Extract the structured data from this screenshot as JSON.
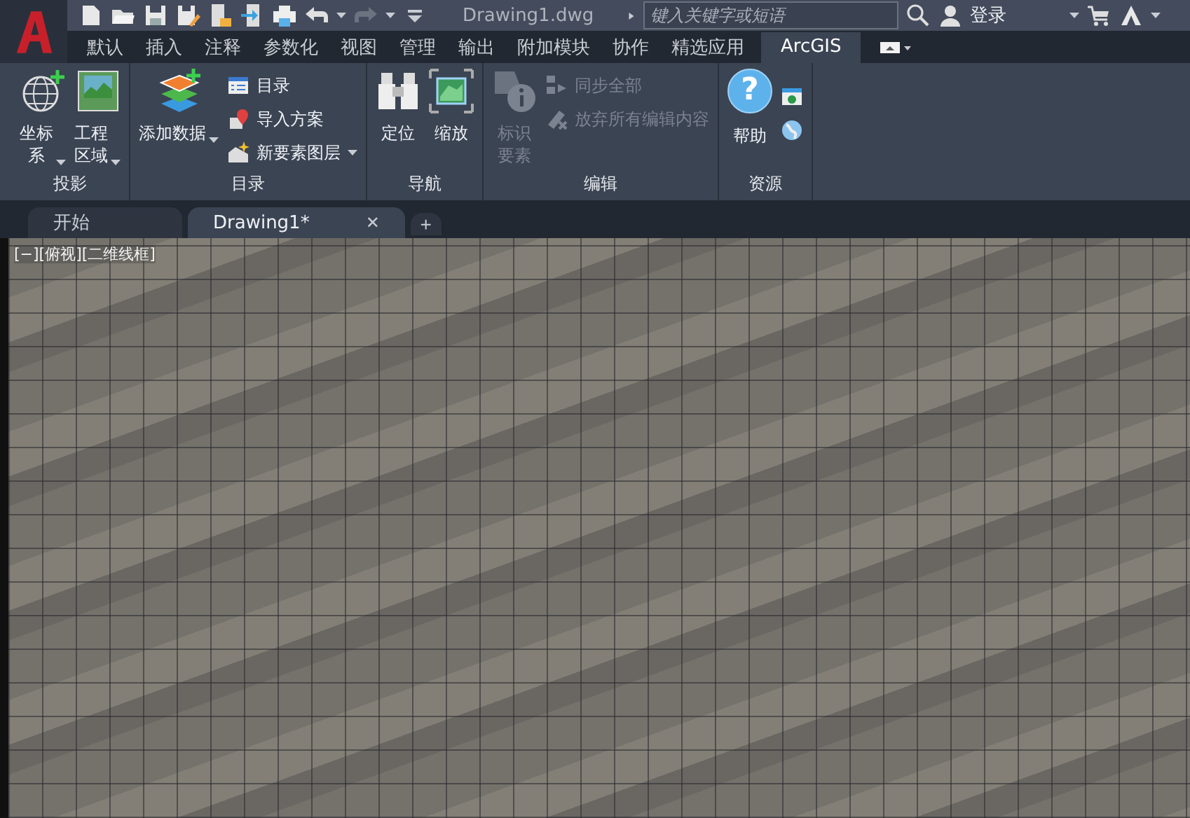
{
  "title_bar": {
    "title": "Drawing1.dwg",
    "search": {
      "placeholder": "键入关键字或短语"
    },
    "login": "登录"
  },
  "ribbon_tabs": [
    {
      "label": "默认",
      "selected": false
    },
    {
      "label": "插入",
      "selected": false
    },
    {
      "label": "注释",
      "selected": false
    },
    {
      "label": "参数化",
      "selected": false
    },
    {
      "label": "视图",
      "selected": false
    },
    {
      "label": "管理",
      "selected": false
    },
    {
      "label": "输出",
      "selected": false
    },
    {
      "label": "附加模块",
      "selected": false
    },
    {
      "label": "协作",
      "selected": false
    },
    {
      "label": "精选应用",
      "selected": false
    },
    {
      "label": "ArcGIS",
      "selected": true
    }
  ],
  "ribbon_panels": [
    {
      "title": "投影",
      "groups": [
        {
          "kind": "large",
          "label_lines": [
            "坐标",
            "系"
          ],
          "dropdown": true,
          "disabled": false
        },
        {
          "kind": "large",
          "label_lines": [
            "工程",
            "区域"
          ],
          "dropdown": true,
          "disabled": false
        }
      ]
    },
    {
      "title": "目录",
      "groups": [
        {
          "kind": "large",
          "label_lines": [
            "添加数据"
          ],
          "dropdown": true,
          "disabled": false
        },
        {
          "kind": "stack",
          "items": [
            {
              "label": "目录",
              "dropdown": false,
              "disabled": false
            },
            {
              "label": "导入方案",
              "dropdown": false,
              "disabled": false
            },
            {
              "label": "新要素图层",
              "dropdown": true,
              "disabled": false
            }
          ]
        }
      ]
    },
    {
      "title": "导航",
      "groups": [
        {
          "kind": "large",
          "label_lines": [
            "定位"
          ],
          "dropdown": false,
          "disabled": false
        },
        {
          "kind": "large",
          "label_lines": [
            "缩放"
          ],
          "dropdown": false,
          "disabled": false
        }
      ]
    },
    {
      "title": "编辑",
      "groups": [
        {
          "kind": "large",
          "label_lines": [
            "标识",
            "要素"
          ],
          "dropdown": false,
          "disabled": true
        },
        {
          "kind": "stack",
          "items": [
            {
              "label": "同步全部",
              "dropdown": false,
              "disabled": true
            },
            {
              "label": "放弃所有编辑内容",
              "dropdown": false,
              "disabled": true
            }
          ]
        }
      ]
    },
    {
      "title": "资源",
      "groups": [
        {
          "kind": "help",
          "glyph": "?",
          "label_lines": [
            "帮助"
          ],
          "dropdown": false,
          "disabled": false
        },
        {
          "kind": "icon_stack"
        }
      ]
    }
  ],
  "doc_tabs": [
    {
      "label": "开始",
      "selected": false
    },
    {
      "label": "Drawing1*",
      "selected": true,
      "close": "✕"
    }
  ],
  "new_tab": "+",
  "viewport": {
    "label": "[−][俯视][二维线框]"
  }
}
